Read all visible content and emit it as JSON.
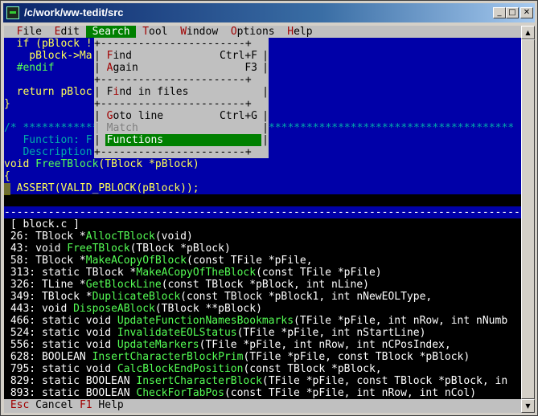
{
  "window": {
    "title": "/c/work/ww-tedit/src"
  },
  "menubar": [
    {
      "pre": "  ",
      "hot": "F",
      "rest": "ile "
    },
    {
      "pre": " ",
      "hot": "E",
      "rest": "dit "
    },
    {
      "pre": " ",
      "hot": "S",
      "rest": "earch ",
      "selected": true
    },
    {
      "pre": " ",
      "hot": "T",
      "rest": "ool "
    },
    {
      "pre": " ",
      "hot": "W",
      "rest": "indow "
    },
    {
      "pre": " ",
      "hot": "O",
      "rest": "ptions "
    },
    {
      "pre": " ",
      "hot": "H",
      "rest": "elp"
    }
  ],
  "editor_lines": [
    {
      "t": "  if (pBlock !",
      "c": "code-y"
    },
    {
      "t": "    pBlock->Ma",
      "c": "code-y"
    },
    {
      "t": "  #endif",
      "c": "code-g"
    },
    {
      "t": "",
      "c": "code-y"
    },
    {
      "t": "  return pBloc",
      "c": "code-y"
    },
    {
      "t": "}",
      "c": "code-y"
    },
    {
      "t": "",
      "c": "code-y"
    },
    {
      "t": "/* *************",
      "c": "code-c",
      "tail": "*************************************** "
    },
    {
      "t": "   Function: F",
      "c": "code-c"
    },
    {
      "t": "   Description",
      "c": "code-c"
    },
    {
      "t": "void FreeTBlock(TBlock *pBlock)",
      "c": "code-y",
      "fn": "FreeTBlock"
    },
    {
      "t": "{",
      "c": "code-y"
    },
    {
      "t": "  ASSERT(VALID_PBLOCK(pBlock));",
      "c": "code-y"
    }
  ],
  "separator": "-------------------------------------------------------------------------------------------------",
  "search_menu": {
    "top": "+-----------------------+",
    "items": [
      {
        "label": "Find",
        "hot": "F",
        "rest": "ind",
        "shortcut": "Ctrl+F",
        "disabled": false
      },
      {
        "label": "Again",
        "hot": "A",
        "rest": "gain",
        "shortcut": "F3",
        "disabled": false
      },
      {
        "sep": true
      },
      {
        "label": "Find in files",
        "hot": "",
        "rest": "Find in files",
        "shortcut": "",
        "disabled": false,
        "hot_mid": "i"
      },
      {
        "sep": true
      },
      {
        "label": "Goto line",
        "hot": "G",
        "rest": "oto line",
        "shortcut": "Ctrl+G",
        "disabled": false
      },
      {
        "label": "Match",
        "hot": "",
        "rest": "Match",
        "shortcut": "",
        "disabled": true
      },
      {
        "label": "Functions",
        "hot": "",
        "rest": "Functions",
        "shortcut": "",
        "disabled": false,
        "highlighted": true
      }
    ]
  },
  "func_list": {
    "header": " [ block.c ]",
    "items": [
      {
        "num": " 26:",
        "pre": " TBlock *",
        "fn": "AllocTBlock",
        "post": "(void)"
      },
      {
        "num": " 43:",
        "pre": " void ",
        "fn": "FreeTBlock",
        "post": "(TBlock *pBlock)"
      },
      {
        "num": " 58:",
        "pre": " TBlock *",
        "fn": "MakeACopyOfBlock",
        "post": "(const TFile *pFile,"
      },
      {
        "num": " 313:",
        "pre": " static TBlock *",
        "fn": "MakeACopyOfTheBlock",
        "post": "(const TFile *pFile)"
      },
      {
        "num": " 326:",
        "pre": " TLine *",
        "fn": "GetBlockLine",
        "post": "(const TBlock *pBlock, int nLine)"
      },
      {
        "num": " 349:",
        "pre": " TBlock *",
        "fn": "DuplicateBlock",
        "post": "(const TBlock *pBlock1, int nNewEOLType,"
      },
      {
        "num": " 443:",
        "pre": " void ",
        "fn": "DisposeABlock",
        "post": "(TBlock **pBlock)"
      },
      {
        "num": " 466:",
        "pre": " static void ",
        "fn": "UpdateFunctionNamesBookmarks",
        "post": "(TFile *pFile, int nRow, int nNumb"
      },
      {
        "num": " 524:",
        "pre": " static void ",
        "fn": "InvalidateEOLStatus",
        "post": "(TFile *pFile, int nStartLine)"
      },
      {
        "num": " 556:",
        "pre": " static void ",
        "fn": "UpdateMarkers",
        "post": "(TFile *pFile, int nRow, int nCPosIndex,"
      },
      {
        "num": " 628:",
        "pre": " BOOLEAN ",
        "fn": "InsertCharacterBlockPrim",
        "post": "(TFile *pFile, const TBlock *pBlock)"
      },
      {
        "num": " 795:",
        "pre": " static void ",
        "fn": "CalcBlockEndPosition",
        "post": "(const TBlock *pBlock,"
      },
      {
        "num": " 829:",
        "pre": " static BOOLEAN ",
        "fn": "InsertCharacterBlock",
        "post": "(TFile *pFile, const TBlock *pBlock, in"
      },
      {
        "num": " 893:",
        "pre": " static BOOLEAN ",
        "fn": "CheckForTabPos",
        "post": "(const TFile *pFile, int nRow, int nCol)"
      }
    ]
  },
  "status": [
    {
      "key": "Esc",
      "label": "Cancel"
    },
    {
      "key": "F1",
      "label": "Help"
    }
  ],
  "colors": {
    "editor_bg": "#0000a8",
    "menu_bg": "#c0c0c0",
    "highlight": "#008000",
    "titlebar": "#0a246a"
  }
}
